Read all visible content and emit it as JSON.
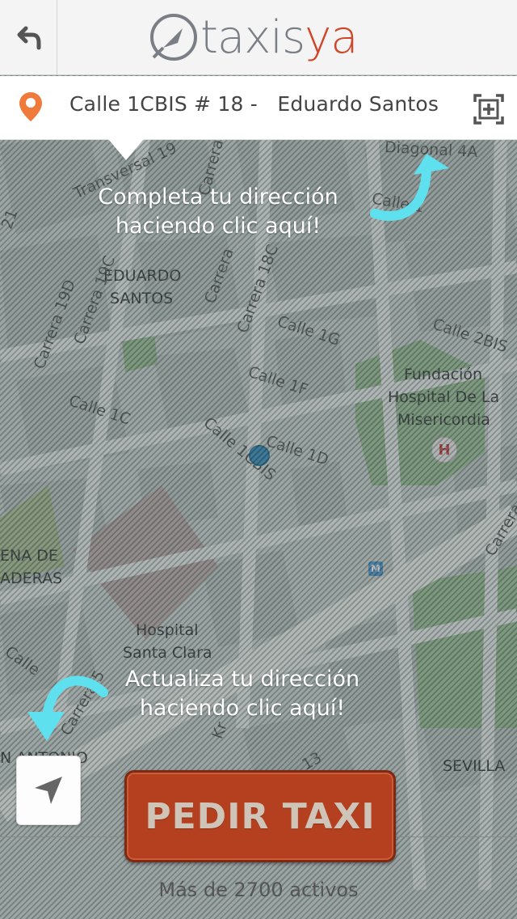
{
  "header": {
    "back_icon": "back-arrow-icon",
    "logo_text_a": "taxis",
    "logo_text_b": "ya",
    "colors": {
      "logo_gray": "#7a7f86",
      "logo_red": "#d0462a"
    }
  },
  "address_bar": {
    "pin_icon": "location-pin-icon",
    "address": "Calle 1CBIS # 18 -   Eduardo Santos",
    "action_icon": "expand-plus-icon",
    "pin_color": "#f07a3c"
  },
  "hints": {
    "top_line1": "Completa tu dirección",
    "top_line2": "haciendo clic aquí!",
    "bottom_line1": "Actualiza tu dirección",
    "bottom_line2": "haciendo clic aquí!",
    "arrow_color": "#5ee0ee"
  },
  "map": {
    "labels": {
      "diagonal_4a": "Diagonal 4A",
      "transversal_19": "Transversal 19",
      "carrera_a": "Carrera",
      "calle_top": "Calle 1",
      "eduardo": "EDUARDO",
      "santos": "SANTOS",
      "carrera_19d": "Carrera 19D",
      "carrera_19c": "Carrera 19C",
      "carrera_18c": "Carrera 18C",
      "carrera_mid": "Carrera",
      "calle_1g": "Calle 1G",
      "calle_2bis": "Calle 2BIS",
      "calle_1f": "Calle 1F",
      "calle_1c": "Calle 1C",
      "calle_1cbis": "Calle 1CBIS",
      "calle_1d": "Calle 1D",
      "fundacion1": "Fundación",
      "fundacion2": "Hospital De La",
      "fundacion3": "Misericordia",
      "hospital_badge": "H",
      "ena_de": "ENA DE",
      "aderas": "ADERAS",
      "metro_badge": "M",
      "hosp_santa1": "Hospital",
      "hosp_santa2": "Santa Clara",
      "calle_left": "Calle",
      "carrera_5": "Carrera 5",
      "n_antonio": "N ANTONIO",
      "sevilla": "SEVILLA",
      "carrera_right": "Carrera",
      "k13": "13",
      "kr": "Kr",
      "n21": "21"
    },
    "location_color": "#2f86b8"
  },
  "controls": {
    "locate_icon": "navigation-arrow-icon",
    "pedir_label": "PEDIR TAXI",
    "activos": "Más de 2700 activos",
    "pedir_color": "#b5401f"
  }
}
